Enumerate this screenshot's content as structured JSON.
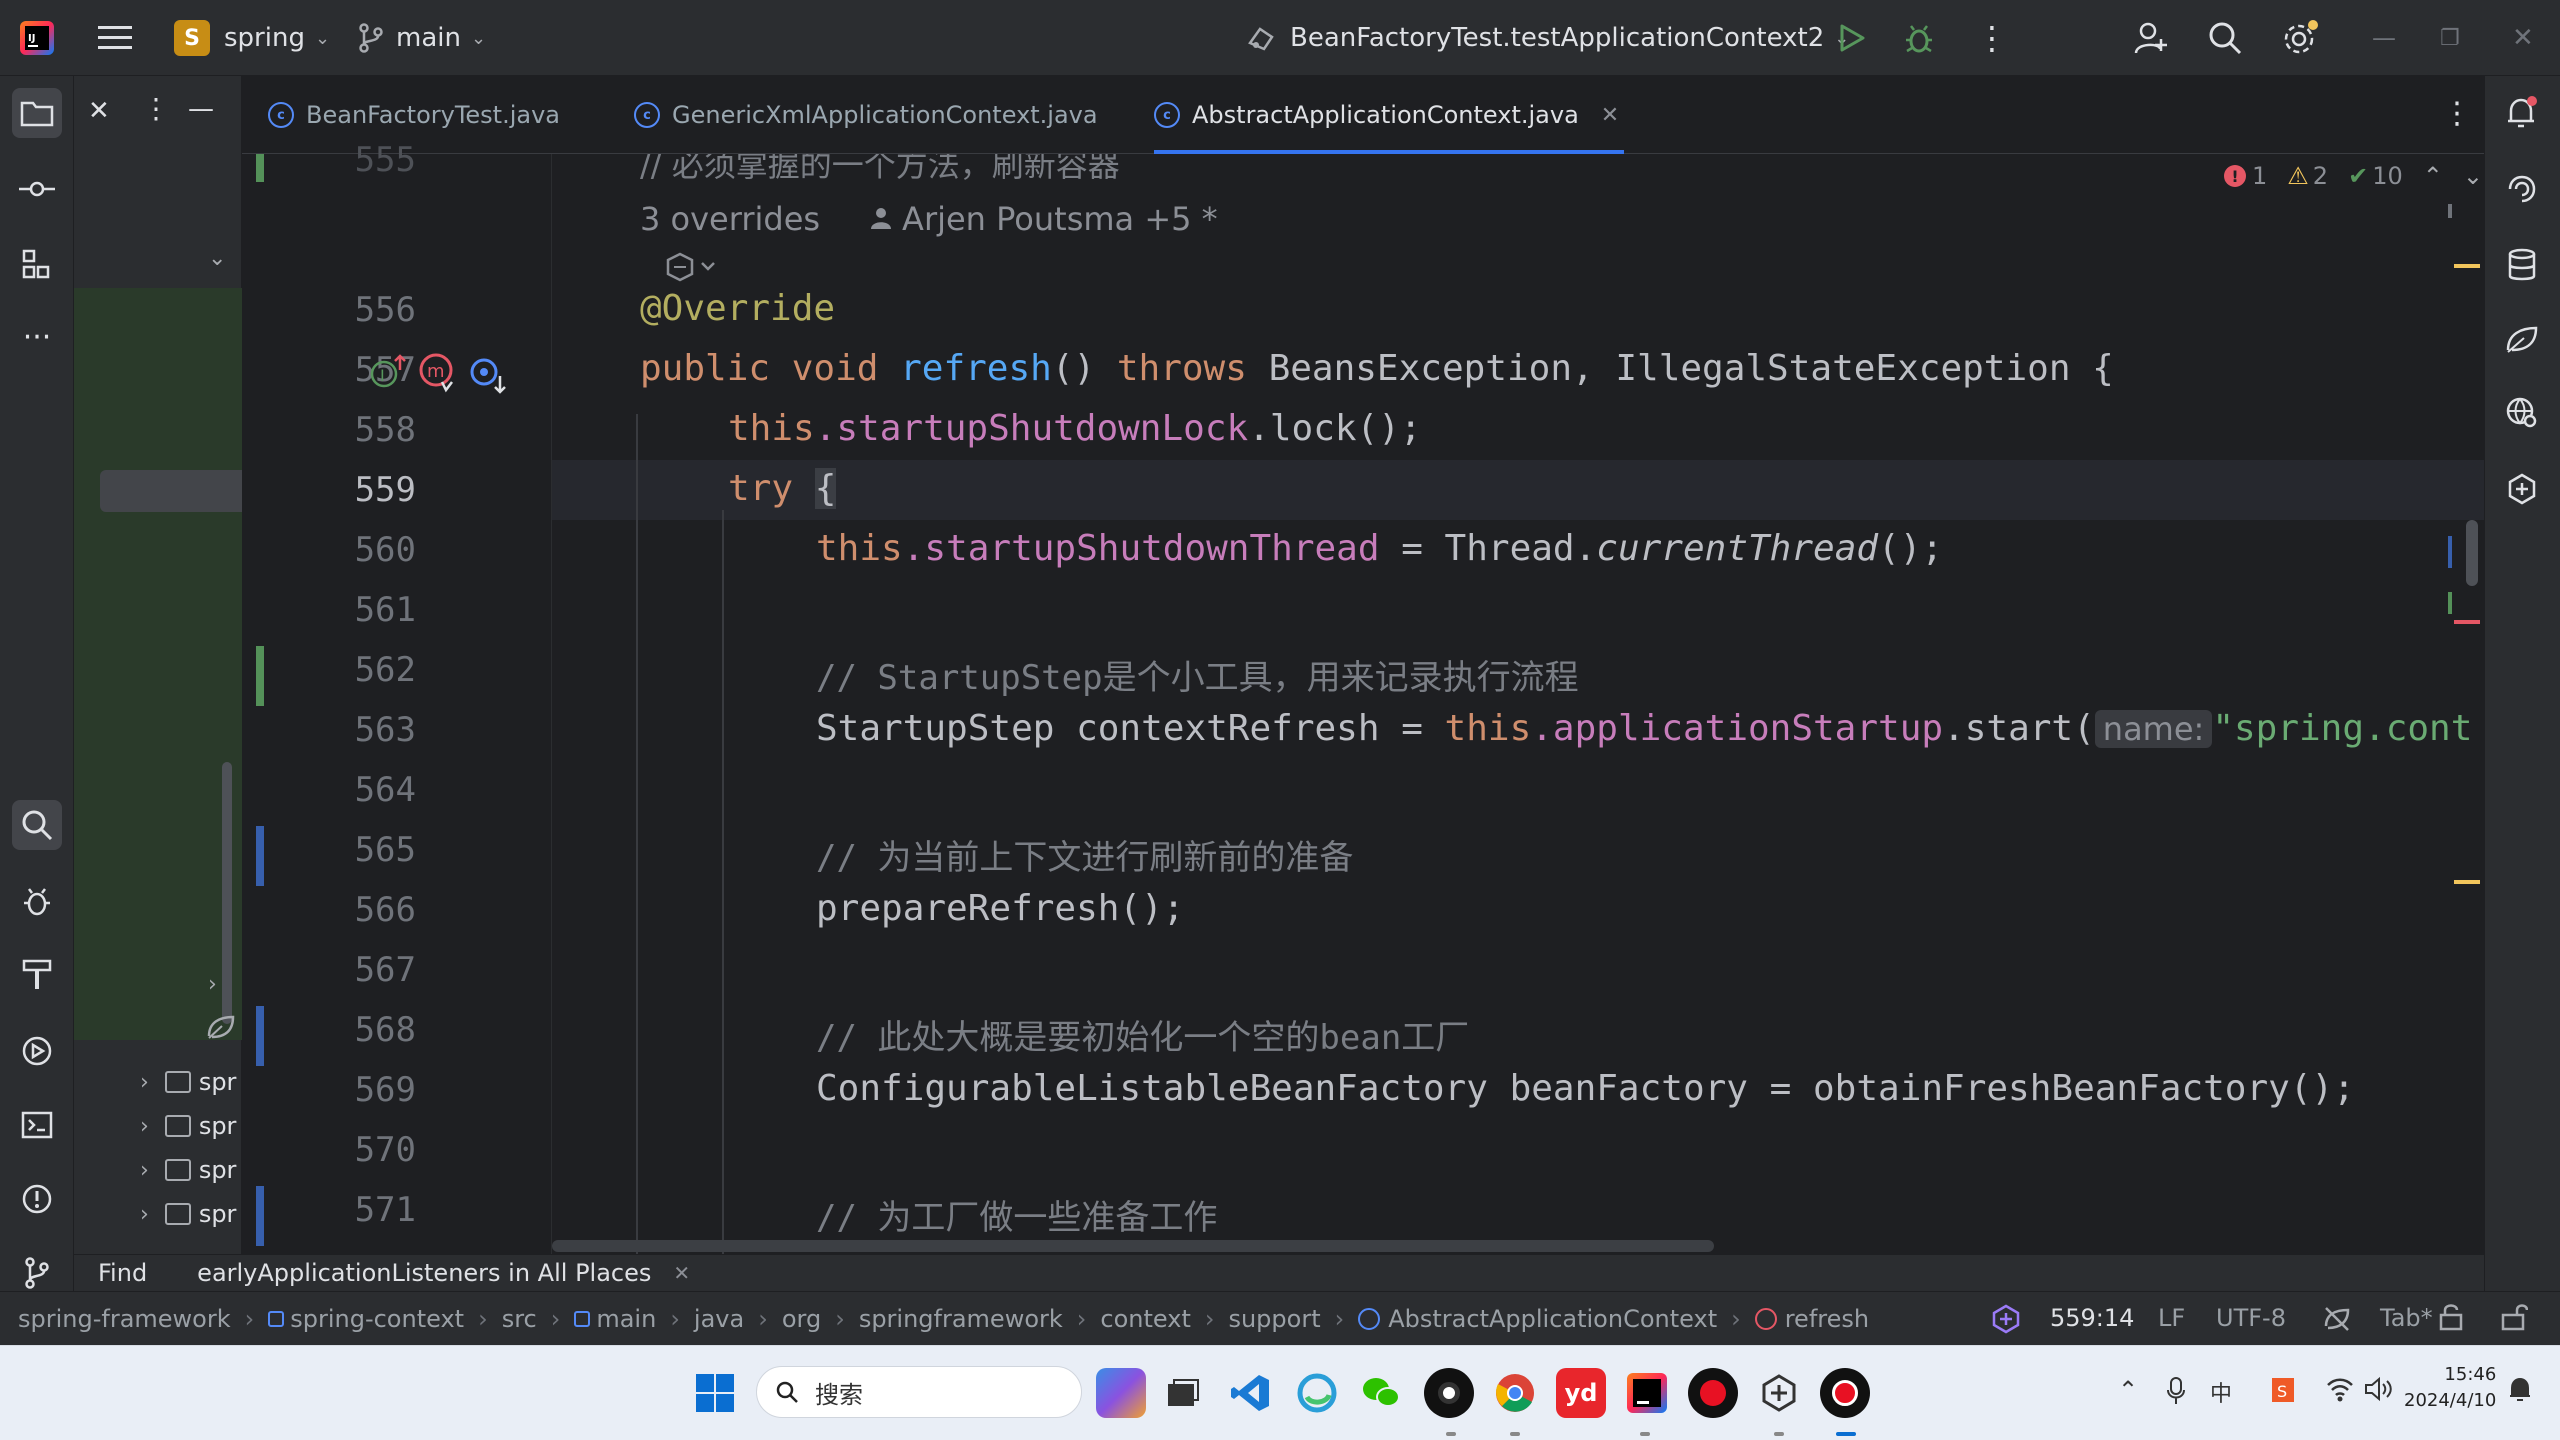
{
  "titlebar": {
    "project_badge": "S",
    "project_name": "spring",
    "branch": "main",
    "run_config": "BeanFactoryTest.testApplicationContext2"
  },
  "tabs": [
    {
      "label": "BeanFactoryTest.java",
      "active": false
    },
    {
      "label": "GenericXmlApplicationContext.java",
      "active": false
    },
    {
      "label": "AbstractApplicationContext.java",
      "active": true
    }
  ],
  "inspections": {
    "errors": "1",
    "warnings": "2",
    "ok": "10"
  },
  "editor": {
    "top_comment": "// 必须掌握的一个方法，刷新容器",
    "line_top": "555",
    "overrides": "3 overrides",
    "authors": "Arjen Poutsma +5 *",
    "lines": {
      "l556": {
        "num": "556",
        "text": "@Override"
      },
      "l557": {
        "num": "557",
        "kw1": "public void ",
        "fn": "refresh",
        "mid": "() ",
        "kw2": "throws ",
        "rest": "BeansException, IllegalStateException {"
      },
      "l558": {
        "num": "558",
        "kw": "this",
        "fld": ".startupShutdownLock",
        "rest": ".lock();"
      },
      "l559": {
        "num": "559",
        "kw": "try ",
        "rest": "{"
      },
      "l560": {
        "num": "560",
        "kw": "this",
        "fld": ".startupShutdownThread",
        "mid": " = Thread.",
        "it": "currentThread",
        "rest": "();"
      },
      "l561": {
        "num": "561"
      },
      "l562": {
        "num": "562",
        "text": "// StartupStep是个小工具，用来记录执行流程"
      },
      "l563": {
        "num": "563",
        "pre": "StartupStep contextRefresh = ",
        "kw": "this",
        "fld": ".applicationStartup",
        "mid": ".start(",
        "hint": "name:",
        "str": "\"spring.cont"
      },
      "l564": {
        "num": "564"
      },
      "l565": {
        "num": "565",
        "text": "// 为当前上下文进行刷新前的准备"
      },
      "l566": {
        "num": "566",
        "text": "prepareRefresh();"
      },
      "l567": {
        "num": "567"
      },
      "l568": {
        "num": "568",
        "text": "// 此处大概是要初始化一个空的bean工厂"
      },
      "l569": {
        "num": "569",
        "text": "ConfigurableListableBeanFactory beanFactory = obtainFreshBeanFactory();"
      },
      "l570": {
        "num": "570"
      },
      "l571": {
        "num": "571",
        "text": "// 为工厂做一些准备工作"
      }
    }
  },
  "project_tree": [
    "spr",
    "spr",
    "spr",
    "spr"
  ],
  "findbar": {
    "title": "Find",
    "tab": "earlyApplicationListeners in All Places"
  },
  "statusbar": {
    "breadcrumbs": [
      "spring-framework",
      "spring-context",
      "src",
      "main",
      "java",
      "org",
      "springframework",
      "context",
      "support",
      "AbstractApplicationContext",
      "refresh"
    ],
    "position": "559:14",
    "line_sep": "LF",
    "encoding": "UTF-8",
    "indent": "Tab*"
  },
  "taskbar": {
    "search_placeholder": "搜索",
    "time": "15:46",
    "date": "2024/4/10",
    "ime": "中"
  },
  "colors": {
    "accent": "#3574f0",
    "error": "#e55765",
    "warning": "#f2c55c"
  }
}
